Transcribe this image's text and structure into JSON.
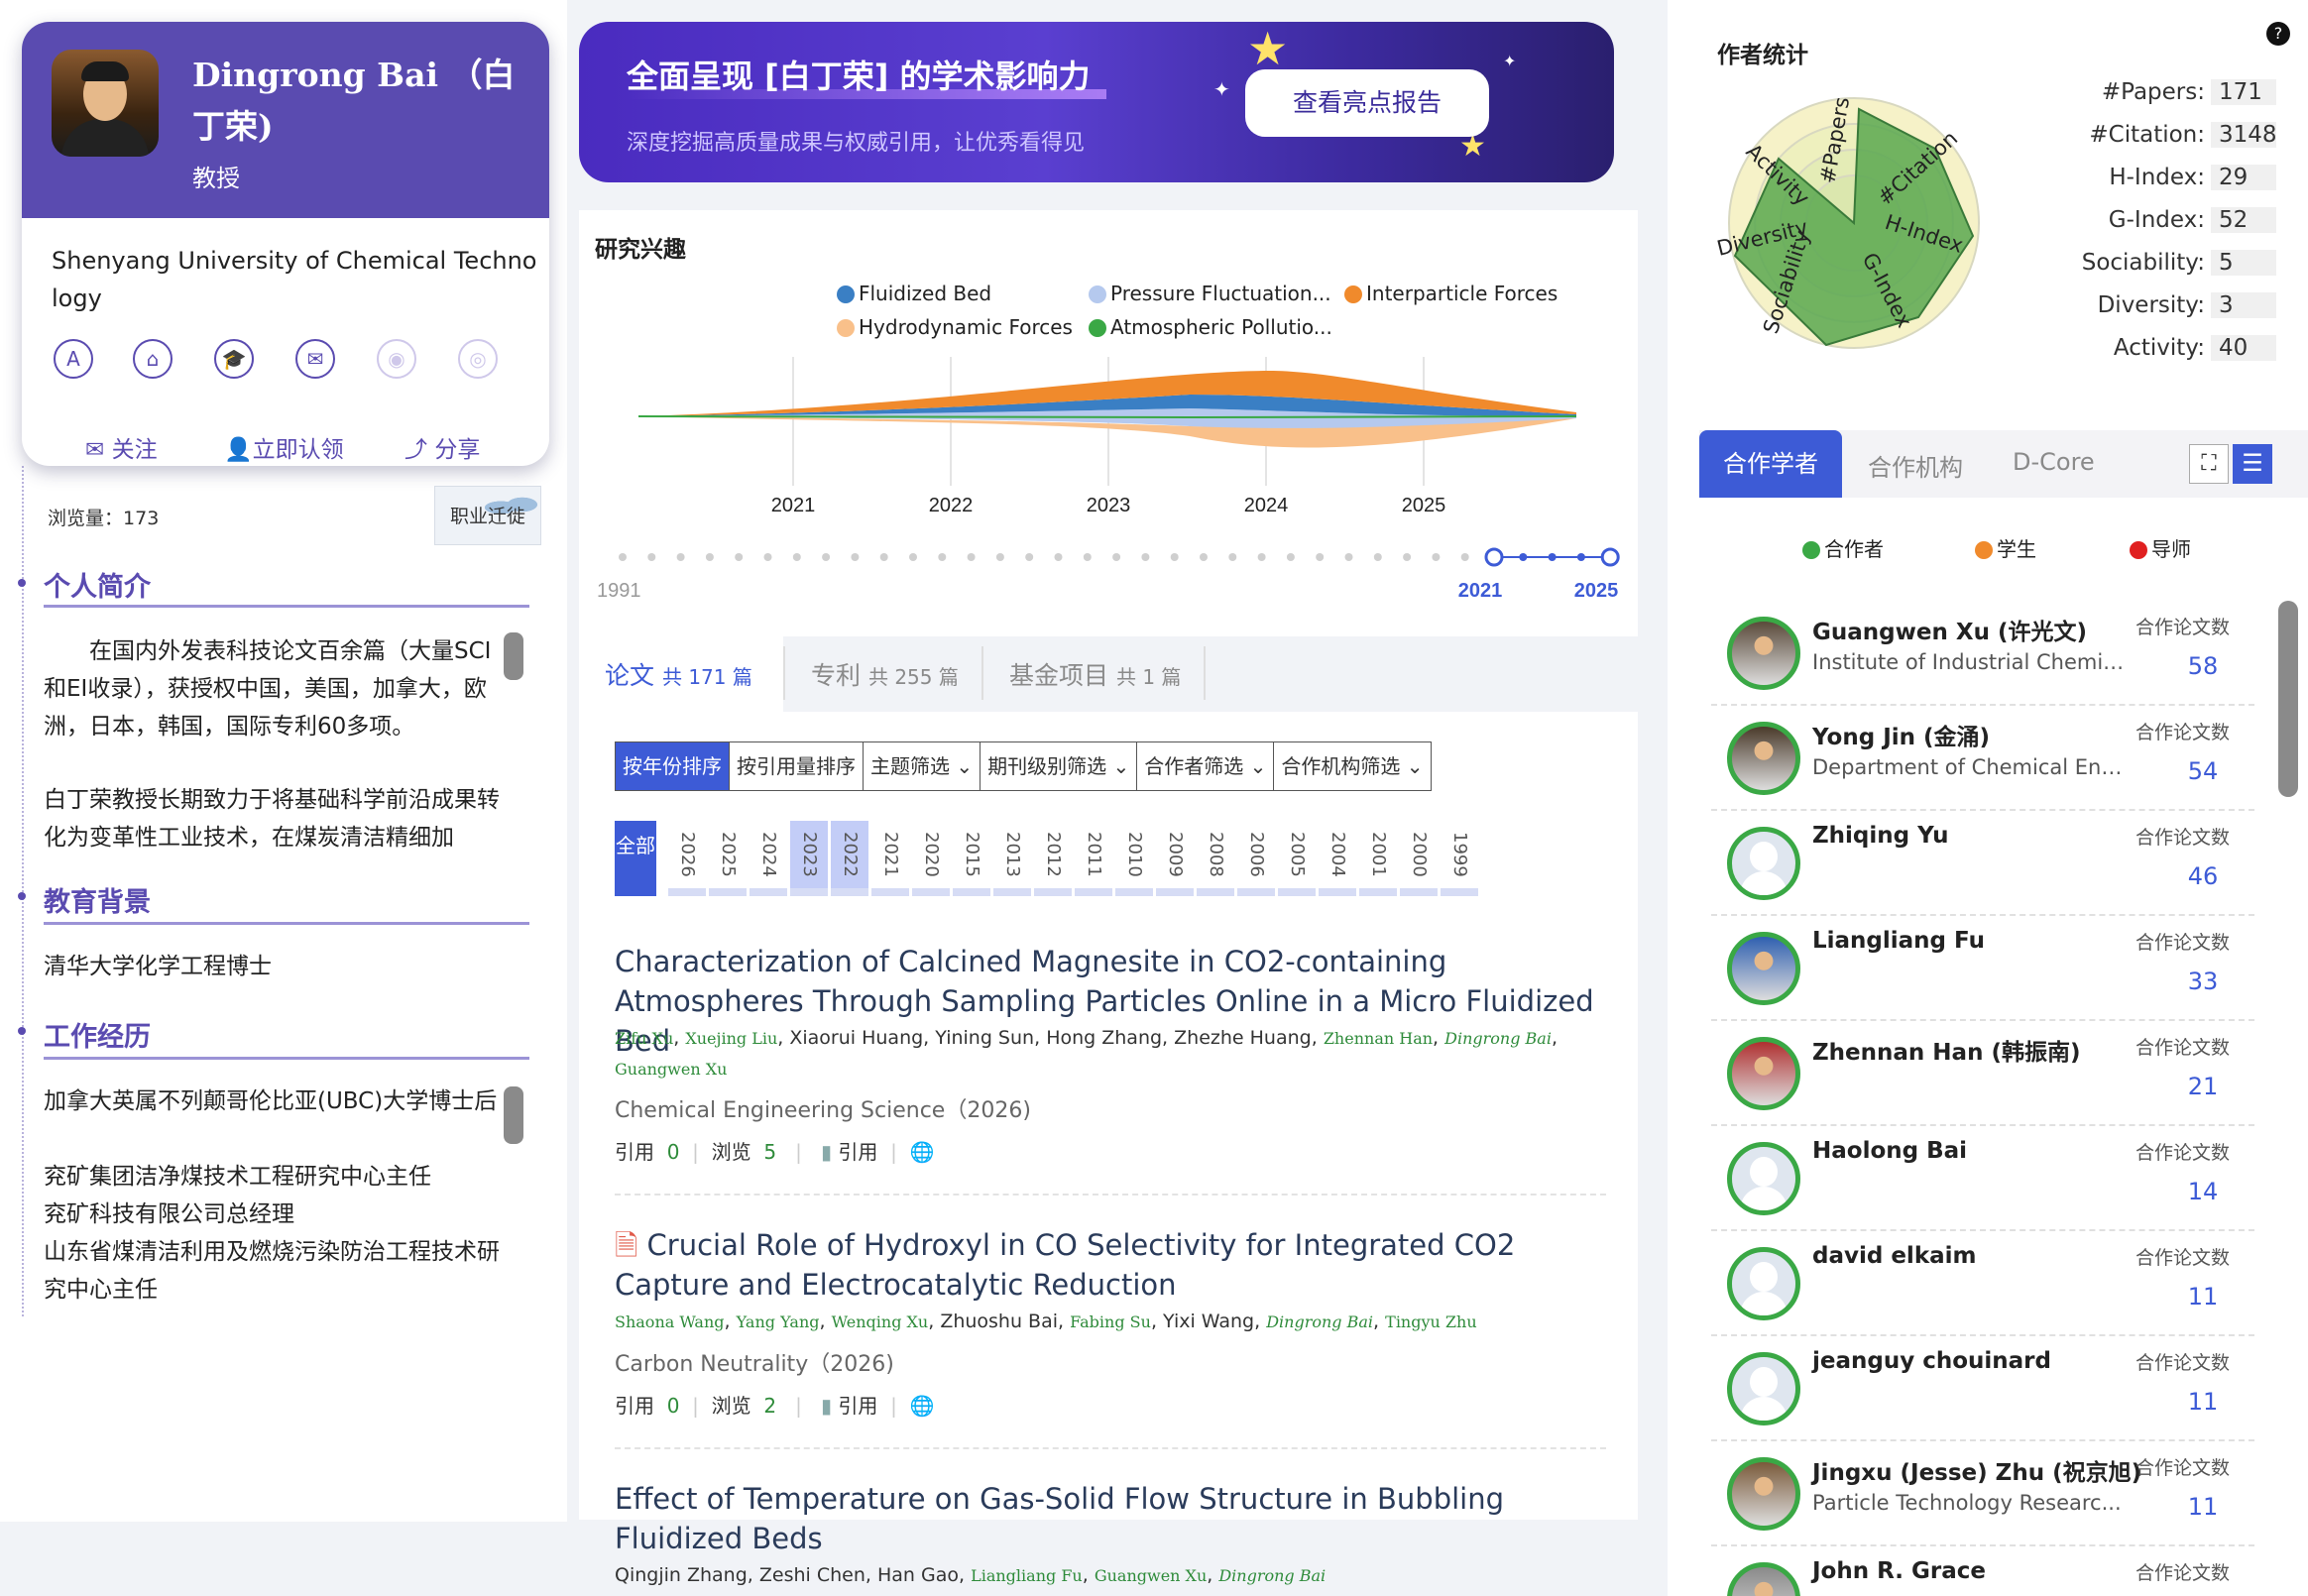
{
  "profile": {
    "name": "Dingrong Bai （白丁荣)",
    "title": "教授",
    "affiliation": "Shenyang University of Chemical Technology",
    "actions": {
      "follow": "关注",
      "claim": "立即认领",
      "share": "分享"
    },
    "views_label": "浏览量：",
    "views": "173",
    "migration_label": "职业迁徙"
  },
  "sections": {
    "intro_title": "个人简介",
    "intro_p1": "在国内外发表科技论文百余篇（大量SCI和EI收录），获授权中国，美国，加拿大，欧洲，日本，韩国，国际专利60多项。",
    "intro_p2": "白丁荣教授长期致力于将基础科学前沿成果转化为变革性工业技术，在煤炭清洁精细加",
    "edu_title": "教育背景",
    "edu_text": "清华大学化学工程博士",
    "work_title": "工作经历",
    "work_items": [
      "加拿大英属不列颠哥伦比亚(UBC)大学博士后",
      "兖矿集团洁净煤技术工程研究中心主任",
      "兖矿科技有限公司总经理",
      "山东省煤清洁利用及燃烧污染防治工程技术研究中心主任"
    ]
  },
  "banner": {
    "title": "全面呈现 [白丁荣] 的学术影响力",
    "subtitle": "深度挖掘高质量成果与权威引用，让优秀看得见",
    "button": "查看亮点报告"
  },
  "chart_data": {
    "type": "area",
    "title": "研究兴趣",
    "x_ticks": [
      "2021",
      "2022",
      "2023",
      "2024",
      "2025"
    ],
    "series": [
      {
        "name": "Fluidized Bed",
        "color": "#3a7fc4"
      },
      {
        "name": "Pressure Fluctuation...",
        "color": "#b5c9ee"
      },
      {
        "name": "Interparticle Forces",
        "color": "#f08a2c"
      },
      {
        "name": "Hydrodynamic Forces",
        "color": "#f9c08a"
      },
      {
        "name": "Atmospheric Pollutio...",
        "color": "#3aa845"
      }
    ],
    "timeline_start": "1991",
    "timeline_range": [
      "2021",
      "2025"
    ]
  },
  "tabs": [
    {
      "label": "论文",
      "count": "共 171 篇"
    },
    {
      "label": "专利",
      "count": "共 255 篇"
    },
    {
      "label": "基金项目",
      "count": "共 1 篇"
    }
  ],
  "sort_buttons": [
    "按年份排序",
    "按引用量排序",
    "主题筛选",
    "期刊级别筛选",
    "合作者筛选",
    "合作机构筛选"
  ],
  "year_filter": {
    "all": "全部",
    "years": [
      "2026",
      "2025",
      "2024",
      "2023",
      "2022",
      "2021",
      "2020",
      "2015",
      "2013",
      "2012",
      "2011",
      "2010",
      "2009",
      "2008",
      "2006",
      "2005",
      "2004",
      "2001",
      "2000",
      "1999"
    ]
  },
  "papers": [
    {
      "title": "Characterization of Calcined Magnesite in CO2-containing Atmospheres Through Sampling Particles Online in a Micro Fluidized Bed",
      "venue": "Chemical Engineering Science（2026)",
      "cite_label": "引用",
      "cite": "0",
      "view_label": "浏览",
      "views": "5",
      "quote": "引用"
    },
    {
      "title": "Crucial Role of Hydroxyl in CO Selectivity for Integrated CO2 Capture and Electrocatalytic Reduction",
      "venue": "Carbon Neutrality（2026)",
      "cite_label": "引用",
      "cite": "0",
      "view_label": "浏览",
      "views": "2",
      "quote": "引用"
    },
    {
      "title": "Effect of Temperature on Gas-Solid Flow Structure in Bubbling Fluidized Beds",
      "venue": "",
      "cite_label": "",
      "cite": "",
      "view_label": "",
      "views": "",
      "quote": ""
    }
  ],
  "author_stats": {
    "title": "作者统计",
    "radar_axes": [
      "#Papers",
      "#Citation",
      "H-Index",
      "G-Index",
      "Sociability",
      "Diversity",
      "Activity"
    ],
    "items": [
      {
        "label": "#Papers:",
        "value": "171"
      },
      {
        "label": "#Citation:",
        "value": "3148"
      },
      {
        "label": "H-Index:",
        "value": "29"
      },
      {
        "label": "G-Index:",
        "value": "52"
      },
      {
        "label": "Sociability:",
        "value": "5"
      },
      {
        "label": "Diversity:",
        "value": "3"
      },
      {
        "label": "Activity:",
        "value": "40"
      }
    ]
  },
  "coauthors": {
    "tabs": [
      "合作学者",
      "合作机构",
      "D-Core"
    ],
    "legend": [
      "合作者",
      "学生",
      "导师"
    ],
    "legend_colors": [
      "#3aa845",
      "#f08a2c",
      "#e02020"
    ],
    "papers_label": "合作论文数",
    "list": [
      {
        "name": "Guangwen Xu (许光文)",
        "org": "Institute of Industrial Chemis...",
        "count": "58"
      },
      {
        "name": "Yong Jin (金涌)",
        "org": "Department of Chemical Eng...",
        "count": "54"
      },
      {
        "name": "Zhiqing Yu",
        "org": "",
        "count": "46"
      },
      {
        "name": "Liangliang Fu",
        "org": "",
        "count": "33"
      },
      {
        "name": "Zhennan Han (韩振南)",
        "org": "",
        "count": "21"
      },
      {
        "name": "Haolong Bai",
        "org": "",
        "count": "14"
      },
      {
        "name": "david elkaim",
        "org": "",
        "count": "11"
      },
      {
        "name": "jeanguy chouinard",
        "org": "",
        "count": "11"
      },
      {
        "name": "Jingxu (Jesse) Zhu (祝京旭)",
        "org": "Particle Technology Researc...",
        "count": "11"
      },
      {
        "name": "John R. Grace",
        "org": "",
        "count": ""
      }
    ]
  }
}
